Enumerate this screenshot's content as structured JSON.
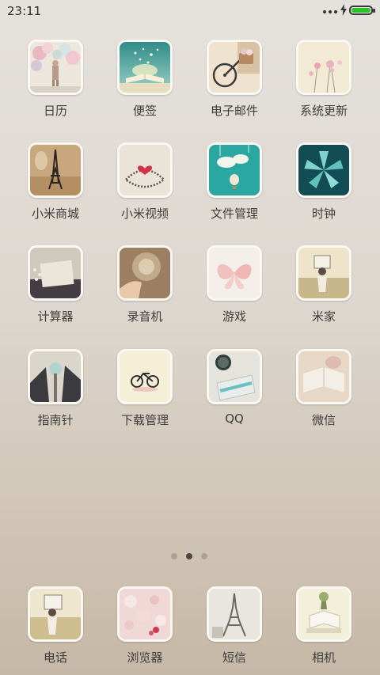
{
  "status_bar": {
    "time": "23:11",
    "battery_level": 1.0,
    "charging": true
  },
  "apps": [
    {
      "label": "日历",
      "icon": "girl-balloons-icon"
    },
    {
      "label": "便签",
      "icon": "glowing-book-icon"
    },
    {
      "label": "电子邮件",
      "icon": "bicycle-basket-icon"
    },
    {
      "label": "系统更新",
      "icon": "flowers-icon"
    },
    {
      "label": "小米商城",
      "icon": "eiffel-bottle-icon"
    },
    {
      "label": "小米视频",
      "icon": "heart-necklace-icon"
    },
    {
      "label": "文件管理",
      "icon": "clouds-hot-air-balloon-icon"
    },
    {
      "label": "时钟",
      "icon": "paper-flower-icon"
    },
    {
      "label": "计算器",
      "icon": "postcard-icon"
    },
    {
      "label": "录音机",
      "icon": "dandelion-hand-icon"
    },
    {
      "label": "游戏",
      "icon": "butterfly-icon"
    },
    {
      "label": "米家",
      "icon": "girl-field-icon"
    },
    {
      "label": "指南针",
      "icon": "water-drop-icon"
    },
    {
      "label": "下载管理",
      "icon": "small-bicycle-icon"
    },
    {
      "label": "QQ",
      "icon": "tea-cup-icon"
    },
    {
      "label": "微信",
      "icon": "open-book-icon"
    }
  ],
  "pager": {
    "count": 3,
    "active": 2
  },
  "dock": [
    {
      "label": "电话",
      "icon": "girl-field-icon"
    },
    {
      "label": "浏览器",
      "icon": "pink-bokeh-icon"
    },
    {
      "label": "短信",
      "icon": "eiffel-tower-icon"
    },
    {
      "label": "相机",
      "icon": "books-plant-icon"
    }
  ]
}
